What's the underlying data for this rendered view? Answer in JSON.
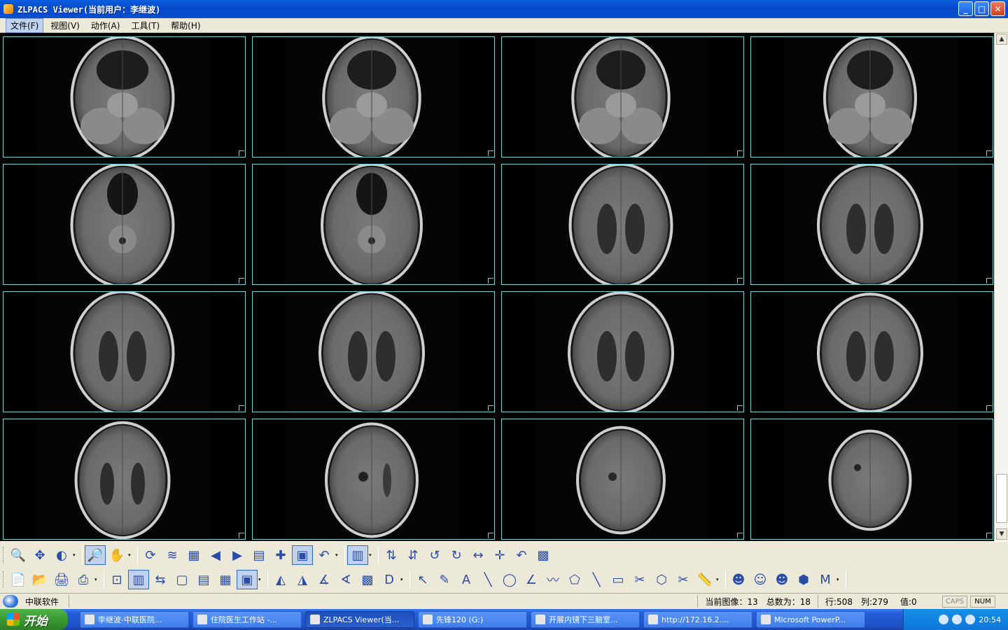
{
  "window": {
    "title": "ZLPACS Viewer(当前用户：李继波)",
    "minimize": "_",
    "maximize": "□",
    "close": "✕"
  },
  "menu": [
    "文件(F)",
    "视图(V)",
    "动作(A)",
    "工具(T)",
    "帮助(H)"
  ],
  "series": {
    "rows": 4,
    "cols": 4,
    "images": [
      {
        "level": "skull-base-1"
      },
      {
        "level": "skull-base-2"
      },
      {
        "level": "posterior-fossa-1"
      },
      {
        "level": "posterior-fossa-2"
      },
      {
        "level": "midbrain-1"
      },
      {
        "level": "midbrain-2"
      },
      {
        "level": "temporal-horn-1"
      },
      {
        "level": "temporal-horn-2"
      },
      {
        "level": "basal-ganglia-1"
      },
      {
        "level": "basal-ganglia-2"
      },
      {
        "level": "lateral-ventricle-1"
      },
      {
        "level": "lateral-ventricle-2"
      },
      {
        "level": "body-ventricle"
      },
      {
        "level": "centrum-semiovale-1"
      },
      {
        "level": "centrum-semiovale-2"
      },
      {
        "level": "vertex"
      }
    ]
  },
  "toolbar_row1": [
    "magnify-icon",
    "zoom-roam-icon",
    "window-level-icon",
    "zoom-icon",
    "hand-icon",
    "rotate-icon",
    "compare-icon",
    "grid-icon",
    "prev-icon",
    "next-icon",
    "layout-icon",
    "sync-icon",
    "frame-icon",
    "undo-icon",
    "split-icon",
    "flip-h-icon",
    "flip-v-icon",
    "rotate-left-icon",
    "rotate-right-icon",
    "resize-h-icon",
    "resize-both-icon",
    "reset-icon",
    "cine-icon"
  ],
  "toolbar_row2": [
    "export-icon",
    "open-folder-icon",
    "print-icon",
    "print-settings-icon",
    "fit-icon",
    "split-view-icon",
    "swap-icon",
    "bound-icon",
    "stack-icon",
    "grid-2-icon",
    "select-layout-icon",
    "triangle-icon",
    "angle-icon",
    "cobb-icon",
    "cobb2-icon",
    "multi-icon",
    "dsa-icon",
    "pointer-icon",
    "annotation-icon",
    "text-icon",
    "line-icon",
    "ellipse-icon",
    "angle-measure-icon",
    "freehand-icon",
    "polygon-icon",
    "arrow-line-icon",
    "rectangle-icon",
    "arrow-cut-icon",
    "roi-icon",
    "scissors-icon",
    "ruler-icon",
    "skull-icon",
    "skull2-icon",
    "skull3-icon",
    "3d-icon",
    "mpr-icon"
  ],
  "status": {
    "company": "中联软件",
    "current_image": "当前图像：13",
    "total": "总数为：18",
    "row": "行:508",
    "col": "列:279",
    "value": "值:0",
    "caps": "CAPS",
    "num": "NUM"
  },
  "taskbar": {
    "start": "开始",
    "tasks": [
      "李继波-中联医院...",
      "住院医生工作站 -...",
      "ZLPACS Viewer(当...",
      "先锋120 (G:)",
      "开展内镜下三脑室...",
      "http://172.16.2....",
      "Microsoft PowerP..."
    ],
    "clock": "20:54"
  }
}
